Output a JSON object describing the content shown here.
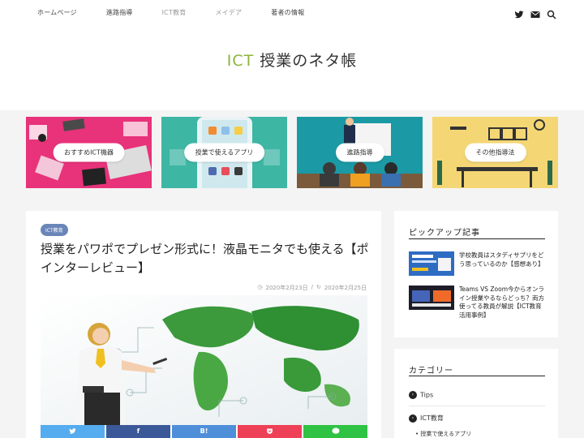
{
  "nav": {
    "items": [
      "ホームページ",
      "進路指導",
      "ICT教育",
      "メイデア",
      "著者の情報"
    ]
  },
  "header_icons": [
    "twitter-icon",
    "mail-icon",
    "search-icon"
  ],
  "site": {
    "title_prefix": "ICT",
    "title_rest": "授業のネタ帳"
  },
  "cards": [
    {
      "label": "おすすめICT機器",
      "bg": "#e8327a"
    },
    {
      "label": "授業で使えるアプリ",
      "bg": "#3eb6a4"
    },
    {
      "label": "進路指導",
      "bg": "#1b9aa6"
    },
    {
      "label": "その他指導法",
      "bg": "#f4d774"
    }
  ],
  "article": {
    "tag": "ICT教育",
    "title": "授業をパワポでプレゼン形式に！液晶モニタでも使える【ポインターレビュー】",
    "published": "2020年2月23日",
    "updated": "2020年2月25日",
    "share": [
      {
        "label": "twitter",
        "color": "#55acee"
      },
      {
        "label": "f",
        "color": "#3b5998"
      },
      {
        "label": "B!",
        "color": "#4f8fd9"
      },
      {
        "label": "pocket",
        "color": "#ee4056"
      },
      {
        "label": "line",
        "color": "#2fc243"
      }
    ]
  },
  "sidebar": {
    "pickup_title": "ピックアップ記事",
    "pickups": [
      {
        "text": "学校教員はスタディサプリをどう思っているのか【感想あり】"
      },
      {
        "text": "Teams VS Zoom今からオンライン授業やるならどっち？両方使ってる教員が解説【ICT教育活用事例】"
      }
    ],
    "category_title": "カテゴリー",
    "categories": [
      "Tips",
      "ICT教育"
    ],
    "subcategory": "授業で使えるアプリ"
  }
}
